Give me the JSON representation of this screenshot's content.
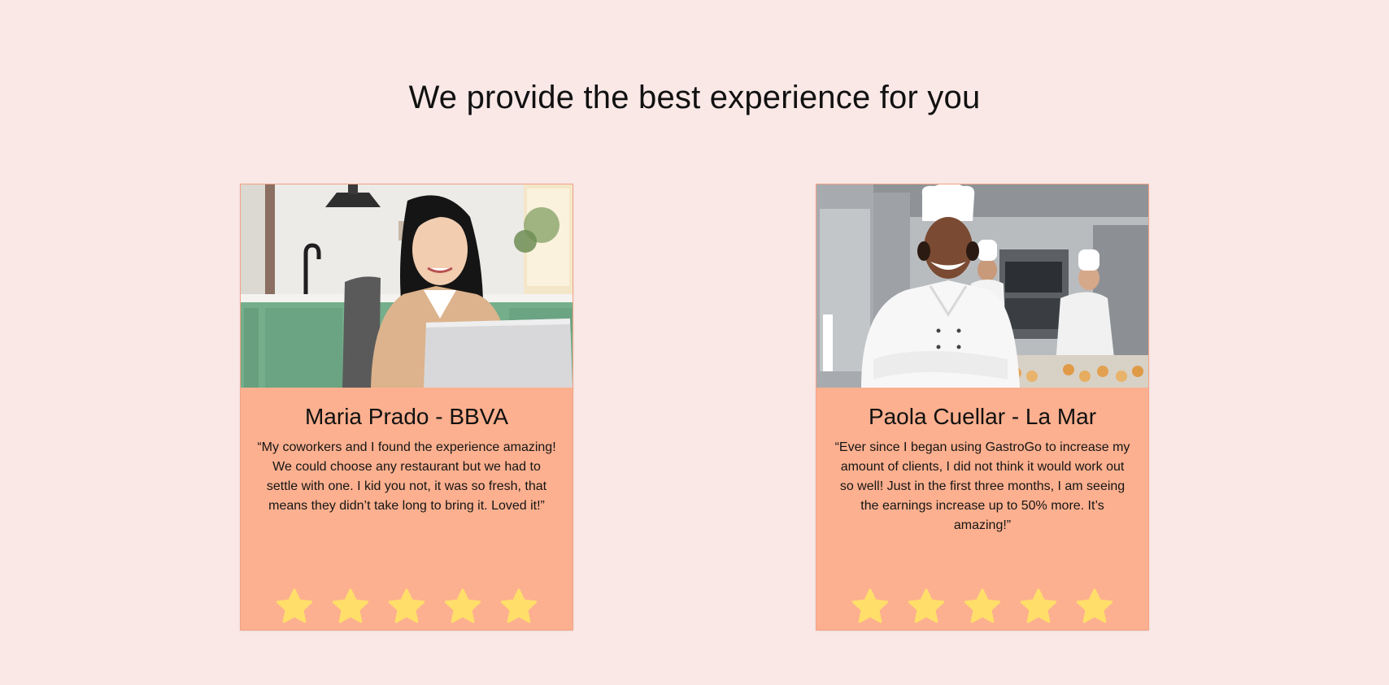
{
  "section": {
    "title": "We provide the best experience for you"
  },
  "testimonials": [
    {
      "name": "Maria Prado - BBVA",
      "quote": "“My coworkers and I found the experience amazing! We could choose any restaurant but we had to settle with one. I kid you not, it was so fresh, that means they didn’t take long to bring it. Loved it!”",
      "rating": 5,
      "rating_max": 5
    },
    {
      "name": "Paola Cuellar - La Mar",
      "quote": "“Ever since I began using GastroGo to increase my amount of clients, I did not think it would work out so well! Just in the first three months, I am seeing the earnings increase up to 50% more. It’s amazing!”",
      "rating": 5,
      "rating_max": 5
    }
  ],
  "colors": {
    "page_background": "#f9e8e6",
    "card_background": "#fcb08f",
    "star": "#ffde6a"
  }
}
